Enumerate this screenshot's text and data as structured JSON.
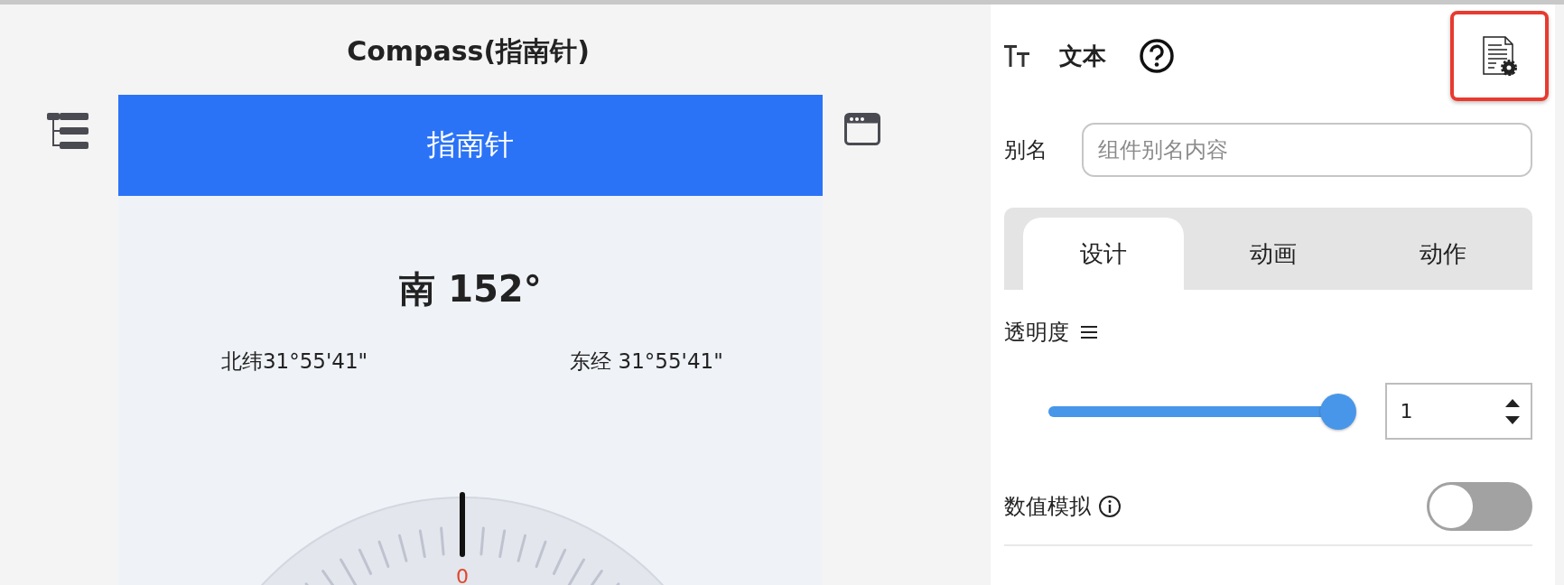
{
  "canvas": {
    "title": "Compass(指南针)",
    "phone": {
      "header": "指南针",
      "heading": "南 152°",
      "latitude": "北纬31°55'41\"",
      "longitude": "东经 31°55'41\"",
      "dial_label": "0"
    }
  },
  "panel": {
    "component": "文本",
    "alias": {
      "label": "别名",
      "placeholder": "组件别名内容"
    },
    "tabs": [
      {
        "label": "设计",
        "selected": true
      },
      {
        "label": "动画",
        "selected": false
      },
      {
        "label": "动作",
        "selected": false
      }
    ],
    "opacity": {
      "label": "透明度",
      "level": 1,
      "value": "1"
    },
    "simulation": {
      "label": "数值模拟",
      "on": false
    }
  }
}
